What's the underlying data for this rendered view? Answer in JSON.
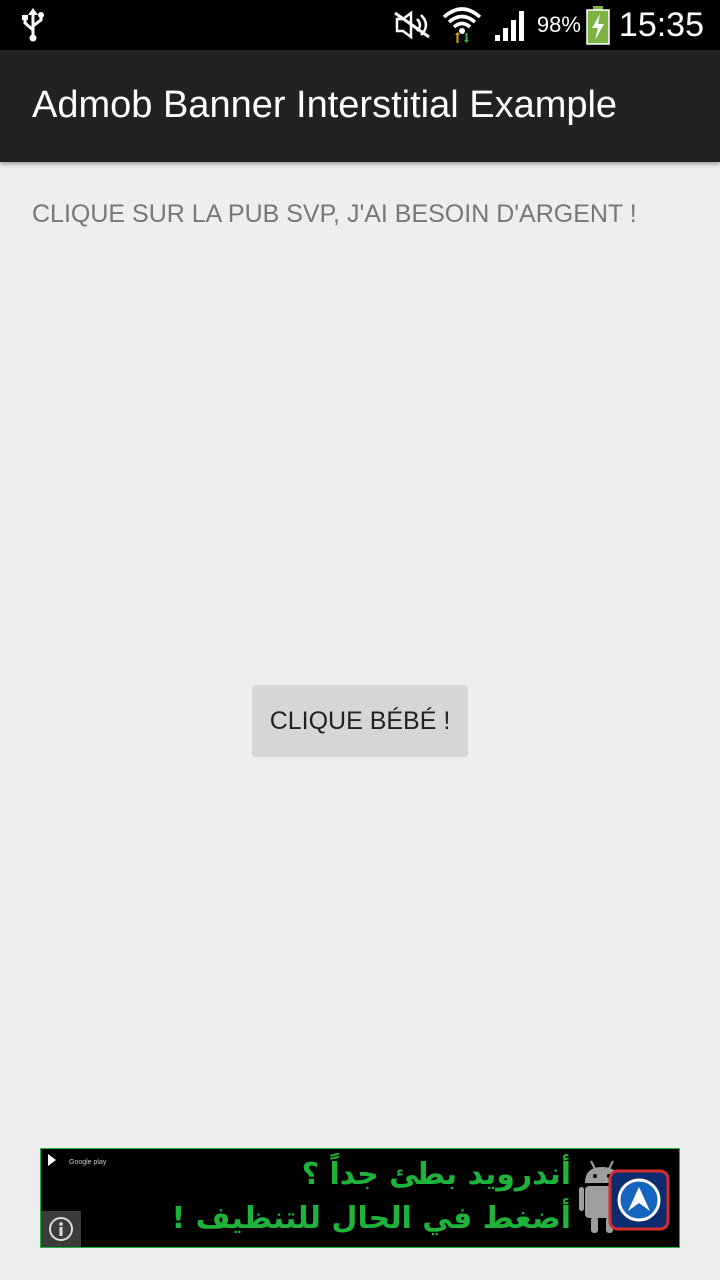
{
  "status_bar": {
    "battery_percent": "98%",
    "time": "15:35",
    "icons": [
      "usb-icon",
      "mute-icon",
      "wifi-icon",
      "signal-icon",
      "battery-charging-icon"
    ]
  },
  "action_bar": {
    "title": "Admob Banner Interstitial Example"
  },
  "main": {
    "message": "CLIQUE SUR LA PUB SVP, J'AI BESOIN D'ARGENT !",
    "button_label": "CLIQUE BÉBÉ !"
  },
  "ad_banner": {
    "line1": "أندرويد بطئ جداً ؟",
    "line2": "أضغط في الحال للتنظيف !",
    "badge": "Google play",
    "text_color": "#1eb33a",
    "icons": [
      "google-play-badge-icon",
      "info-icon",
      "android-robot-icon",
      "booster-app-icon"
    ]
  },
  "colors": {
    "status_bar": "#000000",
    "action_bar": "#222222",
    "background": "#eeeeee",
    "button": "#d6d6d6",
    "ad_green": "#1eb33a"
  }
}
